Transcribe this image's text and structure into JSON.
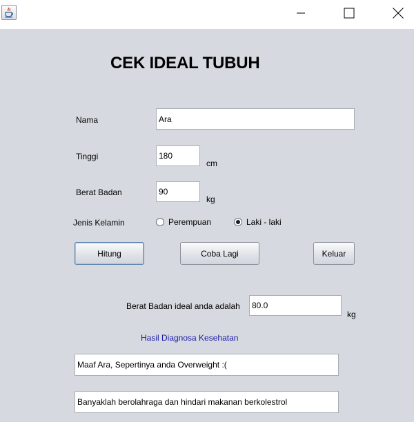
{
  "window": {
    "icon": "java-coffee-icon",
    "controls": {
      "minimize": "minimize-icon",
      "maximize": "maximize-icon",
      "close": "close-icon"
    }
  },
  "form": {
    "heading": "CEK IDEAL TUBUH",
    "nama": {
      "label": "Nama",
      "value": "Ara"
    },
    "tinggi": {
      "label": "Tinggi",
      "value": "180",
      "unit": "cm"
    },
    "berat": {
      "label": "Berat Badan",
      "value": "90",
      "unit": "kg"
    },
    "gender": {
      "label": "Jenis Kelamin",
      "options": [
        {
          "label": "Perempuan",
          "selected": false
        },
        {
          "label": "Laki - laki",
          "selected": true
        }
      ]
    },
    "buttons": {
      "hitung": "Hitung",
      "coba_lagi": "Coba Lagi",
      "keluar": "Keluar"
    }
  },
  "result": {
    "ideal_label": "Berat Badan ideal anda adalah",
    "ideal_value": "80.0",
    "ideal_unit": "kg",
    "diagnosis_title": "Hasil Diagnosa Kesehatan",
    "diagnosis": "Maaf Ara, Sepertinya anda Overweight :(",
    "advice": "Banyaklah berolahraga dan hindari makanan berkolestrol"
  },
  "colors": {
    "background": "#d6d9df",
    "diagnosis_title": "#1b1ba6"
  }
}
